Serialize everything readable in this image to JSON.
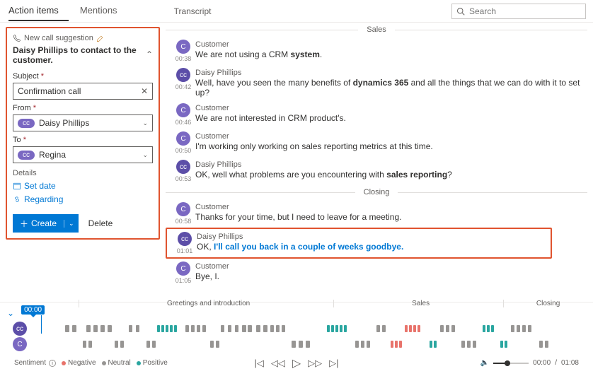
{
  "tabs": {
    "action_items": "Action items",
    "mentions": "Mentions"
  },
  "transcript_label": "Transcript",
  "search": {
    "placeholder": "Search"
  },
  "card": {
    "suggestion_label": "New call suggestion",
    "description": "Daisy Phillips to contact to the customer.",
    "subject_label": "Subject",
    "subject_value": "Confirmation call",
    "from_label": "From",
    "from_value": "Daisy Phillips",
    "to_label": "To",
    "to_value": "Regina",
    "details_label": "Details",
    "set_date": "Set date",
    "regarding": "Regarding",
    "create_label": "Create",
    "delete_label": "Delete",
    "chip_cc": "cc"
  },
  "sections": {
    "sales": "Sales",
    "closing": "Closing"
  },
  "turns": [
    {
      "avatar": "C",
      "time": "00:38",
      "speaker": "Customer",
      "text": "We are not using a CRM <b>system</b>."
    },
    {
      "avatar": "cc",
      "time": "00:42",
      "speaker": "Daisy Phillips",
      "text": "Well, have you seen the many benefits of <b>dynamics 365</b> and all the things that we can do with it to set up?"
    },
    {
      "avatar": "C",
      "time": "00:46",
      "speaker": "Customer",
      "text": "We are not interested in CRM product's."
    },
    {
      "avatar": "C",
      "time": "00:50",
      "speaker": "Customer",
      "text": "I'm working only working on sales reporting metrics at this time."
    },
    {
      "avatar": "cc",
      "time": "00:53",
      "speaker": "Dasiy Phillips",
      "text": "OK, well what problems are you encountering with <b>sales reporting</b>?"
    },
    {
      "avatar": "C",
      "time": "00:58",
      "speaker": "Customer",
      "text": "Thanks for your time, but I need to leave for a meeting."
    },
    {
      "avatar": "cc",
      "time": "01:01",
      "speaker": "Daisy Phillips",
      "text": "OK, <span class=\"ct\">I'll call you back in a couple of weeks goodbye.</span>"
    },
    {
      "avatar": "C",
      "time": "01:05",
      "speaker": "Customer",
      "text": "Bye, I."
    }
  ],
  "timeline": {
    "playhead": "00:00",
    "seg1": "Greetings and introduction",
    "seg2": "Sales",
    "seg3": "Closing",
    "sentiment_label": "Sentiment",
    "neg": "Negative",
    "neu": "Neutral",
    "pos": "Positive",
    "cur": "00:00",
    "dur": "01:08"
  }
}
